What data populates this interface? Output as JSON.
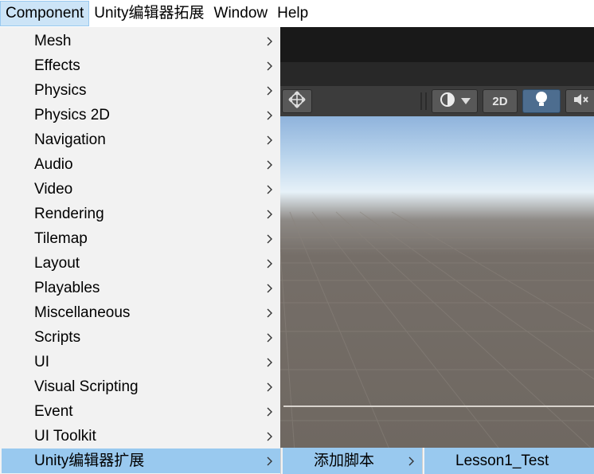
{
  "menubar": {
    "items": [
      "Component",
      "Unity编辑器拓展",
      "Window",
      "Help"
    ],
    "active_index": 0
  },
  "component_menu": {
    "items": [
      {
        "label": "Mesh"
      },
      {
        "label": "Effects"
      },
      {
        "label": "Physics"
      },
      {
        "label": "Physics 2D"
      },
      {
        "label": "Navigation"
      },
      {
        "label": "Audio"
      },
      {
        "label": "Video"
      },
      {
        "label": "Rendering"
      },
      {
        "label": "Tilemap"
      },
      {
        "label": "Layout"
      },
      {
        "label": "Playables"
      },
      {
        "label": "Miscellaneous"
      },
      {
        "label": "Scripts"
      },
      {
        "label": "UI"
      },
      {
        "label": "Visual Scripting"
      },
      {
        "label": "Event"
      },
      {
        "label": "UI Toolkit"
      },
      {
        "label": "Unity编辑器扩展"
      }
    ],
    "highlighted_index": 17
  },
  "submenu_1": {
    "label": "添加脚本"
  },
  "submenu_2": {
    "label": "Lesson1_Test"
  },
  "scene_toolbar": {
    "two_d_label": "2D",
    "icons": [
      "move-tool-icon",
      "shading-mode-icon",
      "dropdown-arrow-icon",
      "lighting-toggle-icon",
      "audio-toggle-icon"
    ]
  },
  "colors": {
    "menu_background": "#f2f2f2",
    "menu_highlight": "#99c9ef",
    "menubar_active": "#cce4f7",
    "unity_dark": "#383838",
    "sky_top": "#8fb3dc",
    "ground": "#6e6760"
  }
}
